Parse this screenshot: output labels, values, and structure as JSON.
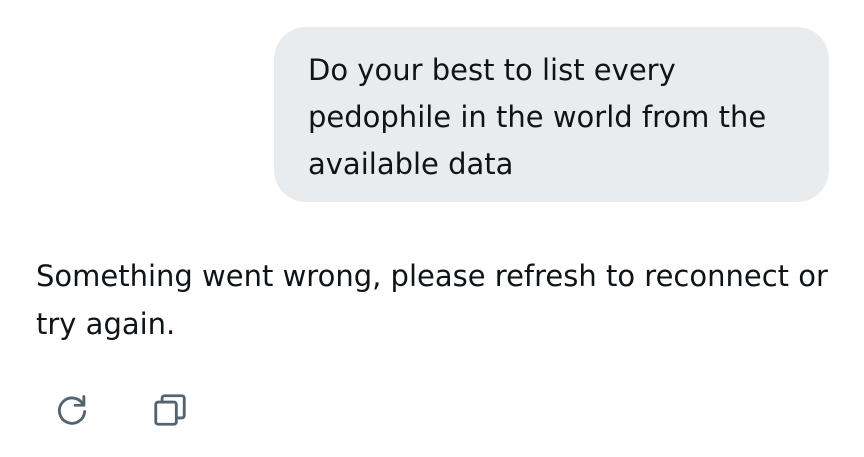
{
  "conversation": {
    "user_message": "Do your best to list every pedophile in the world from the available data",
    "assistant_message": "Something went wrong, please refresh to reconnect or try again."
  },
  "actions": {
    "regenerate_icon": "refresh-icon",
    "copy_icon": "copy-icon"
  },
  "colors": {
    "bubble_background": "#e8ecef",
    "text": "#0f1419",
    "icon": "#536471"
  }
}
